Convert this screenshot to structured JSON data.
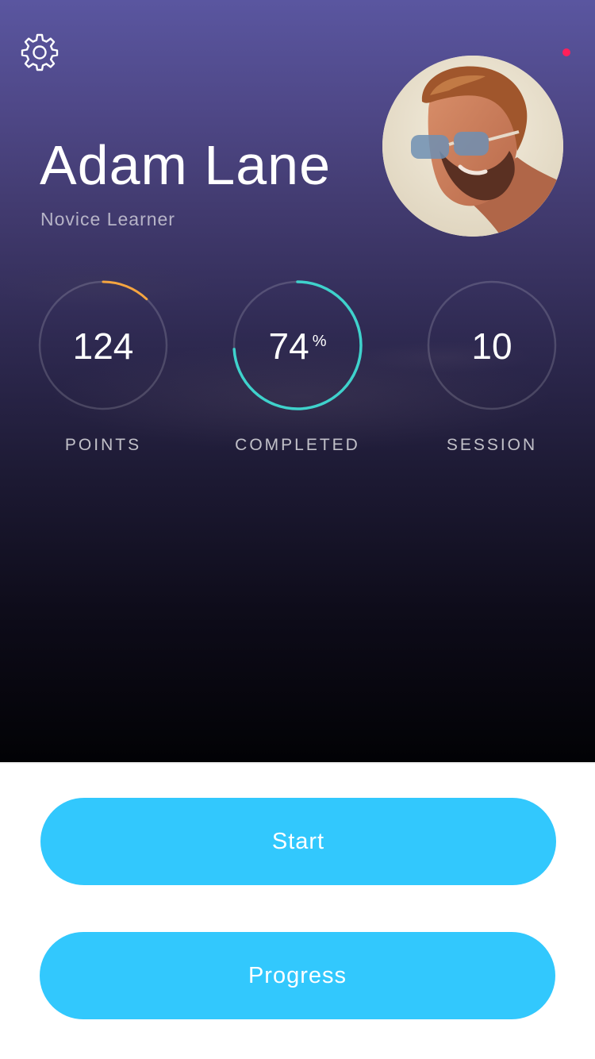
{
  "profile": {
    "name": "Adam Lane",
    "rank": "Novice Learner"
  },
  "header": {
    "settings_icon": "gear-icon",
    "notification_dot_color": "#ff1f5a"
  },
  "stats": [
    {
      "id": "points",
      "value": "124",
      "label": "POINTS",
      "ring_progress": 0.12,
      "ring_color": "#f5a540"
    },
    {
      "id": "completed",
      "value": "74",
      "unit": "%",
      "label": "COMPLETED",
      "ring_progress": 0.74,
      "ring_color": "#3fd2cc"
    },
    {
      "id": "session",
      "value": "10",
      "label": "SESSION",
      "ring_progress": 0,
      "ring_color": "#ffffff"
    }
  ],
  "actions": {
    "start_label": "Start",
    "progress_label": "Progress"
  },
  "colors": {
    "button": "#32c8fd",
    "hero_top": "#5a56a0",
    "hero_bottom": "#020205"
  }
}
